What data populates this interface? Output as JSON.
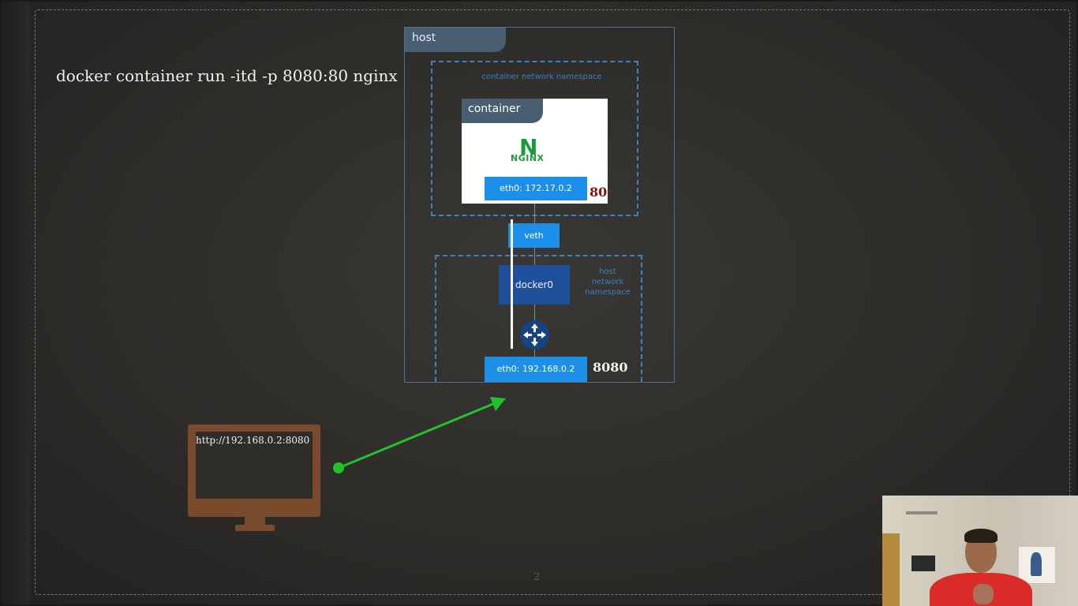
{
  "slide": {
    "command": "docker container run -itd -p 8080:80 nginx",
    "page_number": "2"
  },
  "diagram": {
    "host_label": "host",
    "container_ns_label": "container network namespace",
    "container_label": "container",
    "nginx_logo": {
      "letter": "N",
      "word": "NGINX",
      "color": "#1a9b3a"
    },
    "container_eth": "eth0: 172.17.0.2",
    "container_port": "80",
    "veth_label": "veth",
    "docker0_label": "docker0",
    "host_ns_label": [
      "host",
      "network",
      "namespace"
    ],
    "host_eth": "eth0: 192.168.0.2",
    "host_port": "8080",
    "router_icon": "router-icon"
  },
  "client": {
    "url": "http://192.168.0.2:8080",
    "monitor_icon": "monitor-icon",
    "monitor_color": "#7a4a2c"
  },
  "arrow": {
    "color": "#22c32a"
  },
  "colors": {
    "accent_blue": "#1c8fe8",
    "dashed_blue": "#3f7fc4",
    "tab_gray": "#4a5e72",
    "docker0_blue": "#1f4f9a",
    "port_red": "#8a1010"
  }
}
